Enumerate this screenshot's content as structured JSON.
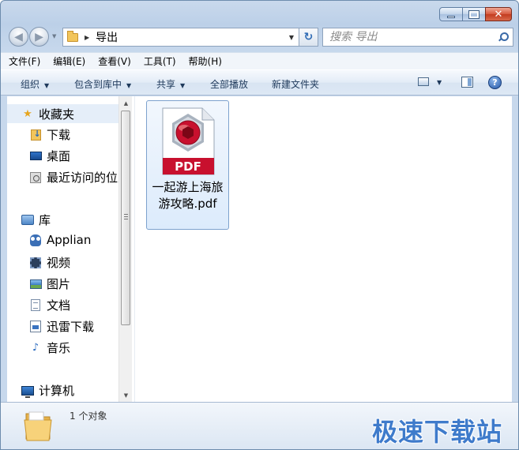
{
  "window": {
    "caption_buttons": {
      "minimize": "minimize",
      "maximize": "maximize",
      "close": "✕"
    }
  },
  "address_bar": {
    "current_folder": "导出"
  },
  "search": {
    "placeholder": "搜索 导出"
  },
  "menubar": {
    "items": [
      "文件(F)",
      "编辑(E)",
      "查看(V)",
      "工具(T)",
      "帮助(H)"
    ]
  },
  "command_bar": {
    "organize": "组织",
    "include_in_library": "包含到库中",
    "share": "共享",
    "play_all": "全部播放",
    "new_folder": "新建文件夹"
  },
  "nav_pane": {
    "favorites": {
      "label": "收藏夹",
      "items": [
        "下载",
        "桌面",
        "最近访问的位置"
      ]
    },
    "libraries": {
      "label": "库",
      "items": [
        "Applian",
        "视频",
        "图片",
        "文档",
        "迅雷下载",
        "音乐"
      ]
    },
    "computer": {
      "label": "计算机"
    }
  },
  "files": [
    {
      "name": "一起游上海旅游攻略.pdf",
      "icon_label": "PDF",
      "icon": "pdf-file-icon"
    }
  ],
  "details_pane": {
    "item_count": "1 个对象"
  },
  "watermark": "极速下载站",
  "colors": {
    "accent": "#2d6fc7",
    "pdf_red": "#c8102e",
    "selection": "#dcebfc"
  }
}
